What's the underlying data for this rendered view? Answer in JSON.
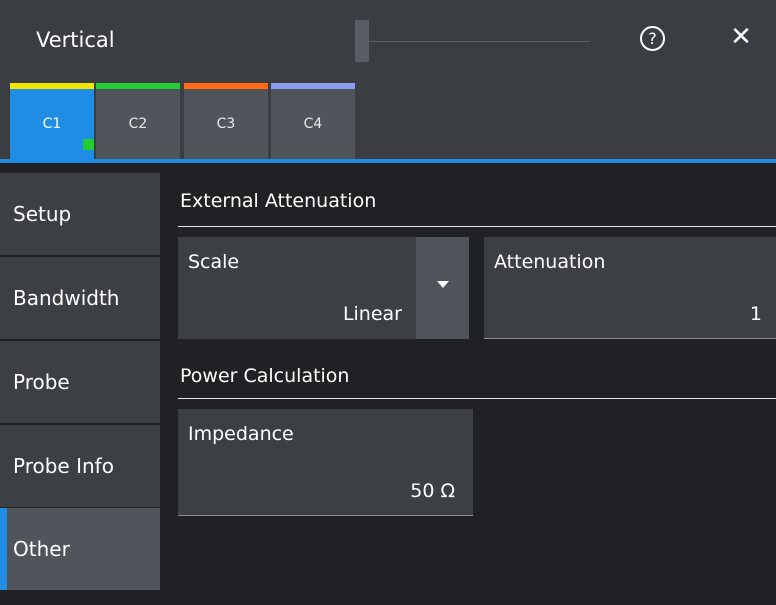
{
  "window": {
    "title": "Vertical",
    "help_icon": "question-circle-icon",
    "help_glyph": "?",
    "close_icon": "close-icon",
    "close_glyph": "✕"
  },
  "tabs": [
    {
      "label": "C1",
      "color": "#f2e600",
      "active": true
    },
    {
      "label": "C2",
      "color": "#22cc33",
      "active": false
    },
    {
      "label": "C3",
      "color": "#ff6a13",
      "active": false
    },
    {
      "label": "C4",
      "color": "#8b9cf2",
      "active": false
    }
  ],
  "sidebar": {
    "items": [
      {
        "label": "Setup"
      },
      {
        "label": "Bandwidth"
      },
      {
        "label": "Probe"
      },
      {
        "label": "Probe Info"
      },
      {
        "label": "Other",
        "active": true
      }
    ]
  },
  "external_attenuation": {
    "title": "External Attenuation",
    "scale": {
      "label": "Scale",
      "value": "Linear"
    },
    "attenuation": {
      "label": "Attenuation",
      "value": "1"
    }
  },
  "power_calculation": {
    "title": "Power Calculation",
    "impedance": {
      "label": "Impedance",
      "value": "50 Ω"
    }
  },
  "colors": {
    "accent": "#1f8de3",
    "channel_active_indicator": "#22cc33"
  }
}
